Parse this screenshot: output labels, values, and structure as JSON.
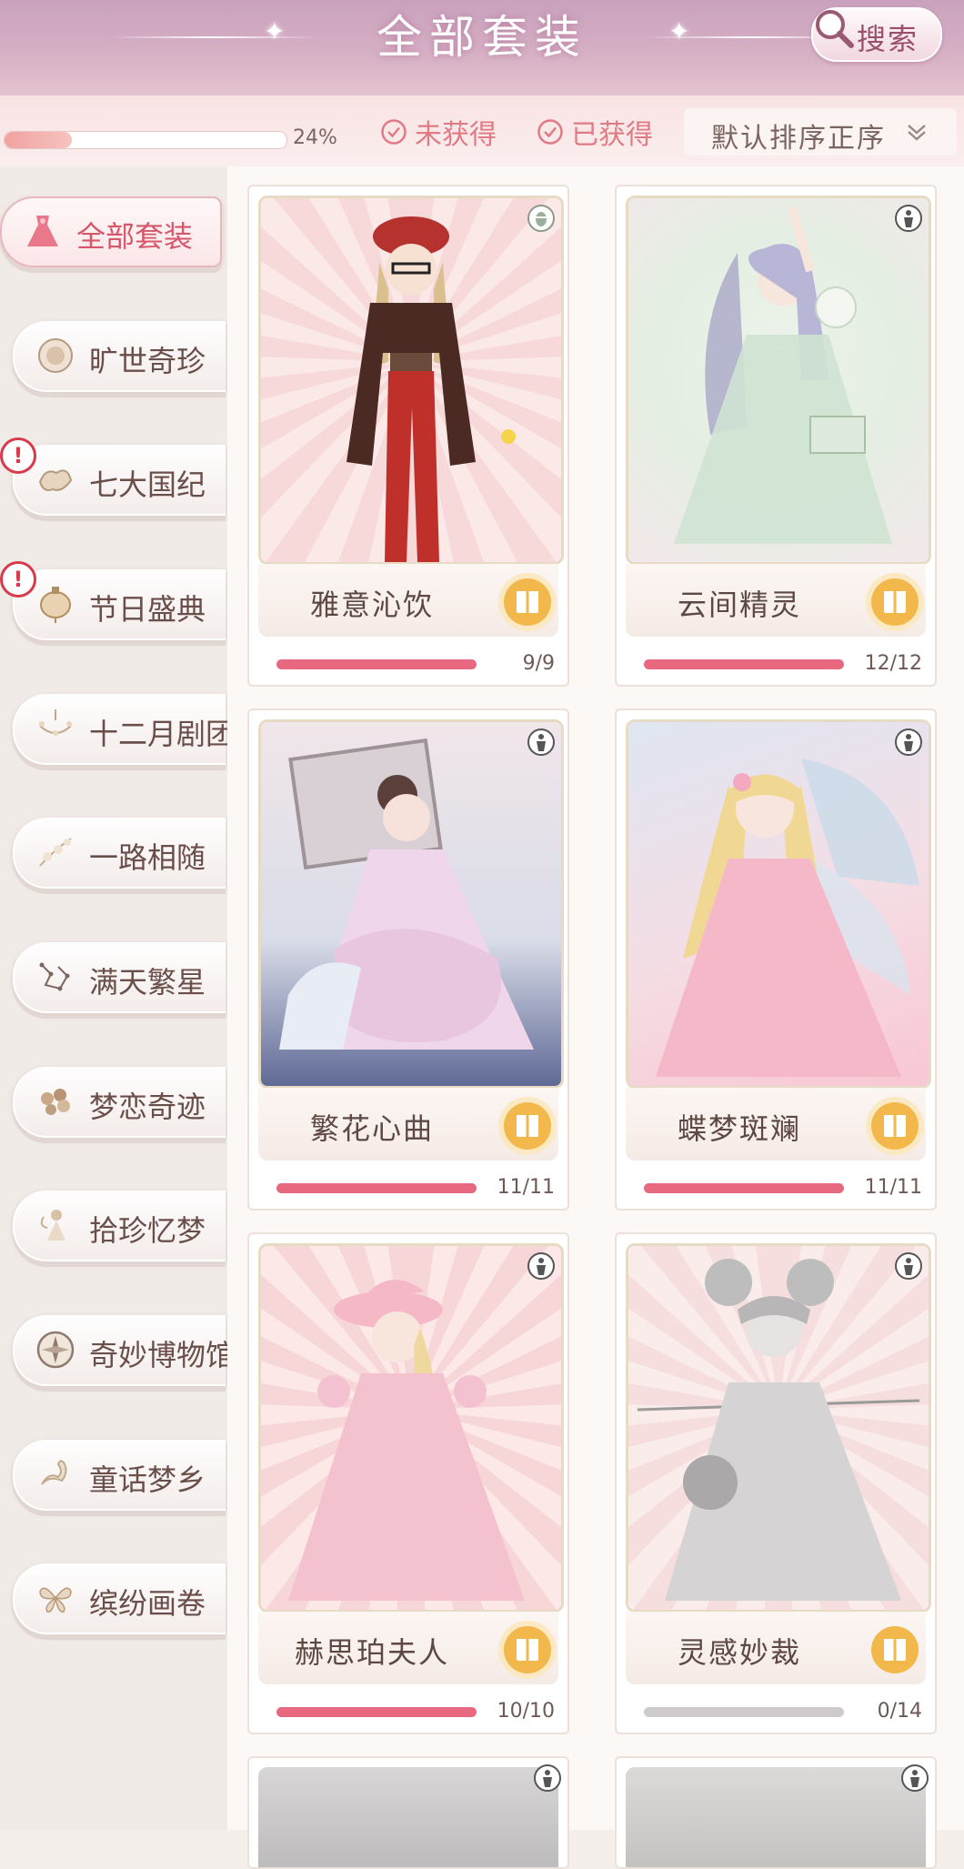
{
  "header": {
    "title": "全部套装",
    "search_label": "搜索"
  },
  "filter": {
    "progress_text": "24%",
    "progress_value": 0.24,
    "not_obtained_label": "未获得",
    "obtained_label": "已获得",
    "sort_label": "默认排序正序"
  },
  "sidebar": {
    "items": [
      {
        "label": "全部套装",
        "active": true
      },
      {
        "label": "旷世奇珍"
      },
      {
        "label": "七大国纪",
        "alert": true
      },
      {
        "label": "节日盛典",
        "alert": true
      },
      {
        "label": "十二月剧团"
      },
      {
        "label": "一路相随"
      },
      {
        "label": "满天繁星"
      },
      {
        "label": "梦恋奇迹"
      },
      {
        "label": "拾珍忆梦"
      },
      {
        "label": "奇妙博物馆"
      },
      {
        "label": "童话梦乡"
      },
      {
        "label": "缤纷画卷"
      }
    ],
    "alert_glyph": "!"
  },
  "cards": [
    {
      "name": "雅意沁饮",
      "count": "9/9",
      "progress": 1.0,
      "bar_color": "#e8697f"
    },
    {
      "name": "云间精灵",
      "count": "12/12",
      "progress": 1.0,
      "bar_color": "#e8697f"
    },
    {
      "name": "繁花心曲",
      "count": "11/11",
      "progress": 1.0,
      "bar_color": "#e8697f"
    },
    {
      "name": "蝶梦斑斓",
      "count": "11/11",
      "progress": 1.0,
      "bar_color": "#e8697f"
    },
    {
      "name": "赫思珀夫人",
      "count": "10/10",
      "progress": 1.0,
      "bar_color": "#e8697f"
    },
    {
      "name": "灵感妙裁",
      "count": "0/14",
      "progress": 0.0,
      "bar_color": "#cfcbca"
    }
  ],
  "colors": {
    "accent": "#e8697f",
    "gold": "#f2b84b",
    "header": "#c9a1bd"
  }
}
